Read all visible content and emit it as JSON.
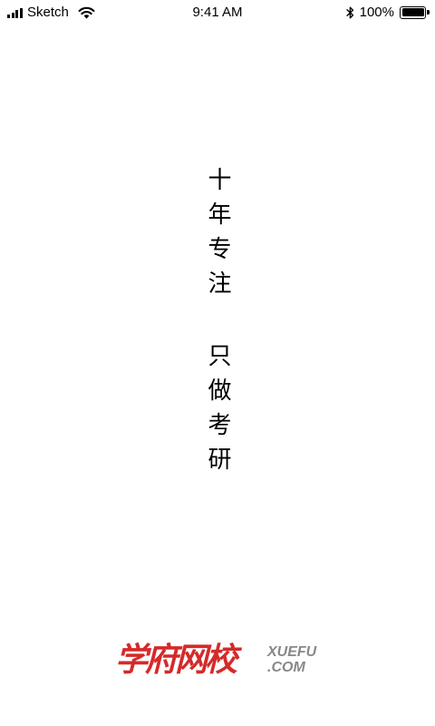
{
  "status_bar": {
    "carrier": "Sketch",
    "time": "9:41 AM",
    "battery_percent": "100%",
    "battery_level": 1.0,
    "icons": [
      "signal-icon",
      "wifi-icon",
      "bluetooth-icon",
      "battery-icon"
    ]
  },
  "slogan": {
    "line1": "十年专注",
    "line2": "只做考研"
  },
  "logo": {
    "name_cn": "学府网校",
    "domain_top": "XUEFU",
    "domain_bottom": ".COM",
    "colors": {
      "name_cn": "#d42a2a",
      "domain": "#888888"
    }
  }
}
